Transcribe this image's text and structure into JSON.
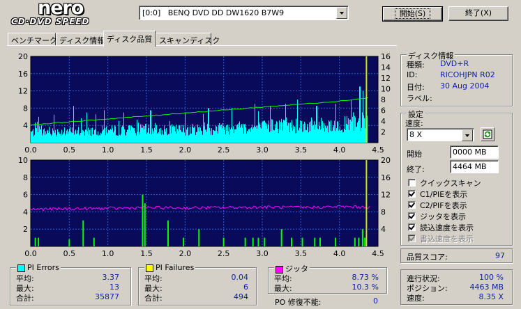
{
  "header": {
    "logo_main": "nero",
    "logo_sub": "CD·DVD SPEED",
    "drive": "[0:0]   BENQ DVD DD DW1620 B7W9",
    "start_label": "開始(S)",
    "stop_label": "終了(X)"
  },
  "tabs": [
    {
      "label": "ベンチマーク",
      "active": false
    },
    {
      "label": "ディスク情報",
      "active": false
    },
    {
      "label": "ディスク品質",
      "active": true
    },
    {
      "label": "スキャンディスク",
      "active": false
    }
  ],
  "disc_info": {
    "title": "ディスク情報",
    "type_label": "種類:",
    "type_value": "DVD+R",
    "id_label": "ID:",
    "id_value": "RICOHJPN R02",
    "date_label": "日付:",
    "date_value": "30 Aug 2004",
    "label_label": "ラベル:"
  },
  "settings": {
    "title": "設定",
    "speed_label": "速度:",
    "speed_value": "8 X",
    "start_label": "開始",
    "start_value": "0000 MB",
    "end_label": "終了:",
    "end_value": "4464 MB",
    "checkboxes": [
      {
        "label": "クイックスキャン",
        "checked": false,
        "disabled": false
      },
      {
        "label": "C1/PIEを表示",
        "checked": true,
        "disabled": false
      },
      {
        "label": "C2/PIFを表示",
        "checked": true,
        "disabled": false
      },
      {
        "label": "ジッタを表示",
        "checked": true,
        "disabled": false
      },
      {
        "label": "読込速度を表示",
        "checked": true,
        "disabled": false
      },
      {
        "label": "書込速度を表示",
        "checked": true,
        "disabled": true
      }
    ]
  },
  "quality": {
    "label": "品質スコア:",
    "value": "97"
  },
  "progress": {
    "status_label": "進行状況:",
    "status_value": "100 %",
    "position_label": "ポジション:",
    "position_value": "4463 MB",
    "speed_label": "速度:",
    "speed_value": "8.35 X"
  },
  "stats": {
    "pi_errors": {
      "title": "PI Errors",
      "color": "#00ffff",
      "avg_label": "平均:",
      "avg": "3.37",
      "max_label": "最大:",
      "max": "13",
      "total_label": "合計:",
      "total": "35877"
    },
    "pi_failures": {
      "title": "PI Failures",
      "color": "#ffff00",
      "avg_label": "平均:",
      "avg": "0.04",
      "max_label": "最大:",
      "max": "6",
      "total_label": "合計:",
      "total": "494"
    },
    "jitter": {
      "title": "ジッタ",
      "color": "#ff00ff",
      "avg_label": "平均:",
      "avg": "8.73 %",
      "max_label": "最大:",
      "max": "10.3 %"
    },
    "po": {
      "label": "PO 修復不能:",
      "value": "0"
    }
  },
  "chart_data": [
    {
      "type": "area",
      "xlim": [
        0,
        4.5
      ],
      "ylim_left": [
        0,
        20
      ],
      "ylim_right": [
        0,
        16
      ],
      "x_ticks": [
        "0.0",
        "0.5",
        "1.0",
        "1.5",
        "2.0",
        "2.5",
        "3.0",
        "3.5",
        "4.0",
        "4.5"
      ],
      "y_ticks_left": [
        "20",
        "16",
        "12",
        "8",
        "4"
      ],
      "y_ticks_right": [
        "16",
        "14",
        "12",
        "10",
        "8",
        "6",
        "4",
        "2"
      ],
      "background": "#0a0a5a",
      "grid_color": "#2f5fd0",
      "series": [
        {
          "role": "pi_errors",
          "color": "#00ffff",
          "axis": "left",
          "x_end": 4.36,
          "base_profile": [
            [
              0,
              2.4
            ],
            [
              0.5,
              2.6
            ],
            [
              1.0,
              2.8
            ],
            [
              1.5,
              3.0
            ],
            [
              2.0,
              3.0
            ],
            [
              2.5,
              3.3
            ],
            [
              3.0,
              3.6
            ],
            [
              3.5,
              4.0
            ],
            [
              4.0,
              4.2
            ],
            [
              4.36,
              4.5
            ]
          ],
          "spikes": [
            [
              0.1,
              6
            ],
            [
              0.3,
              6.5
            ],
            [
              0.55,
              8.5
            ],
            [
              0.72,
              7
            ],
            [
              0.95,
              7.5
            ],
            [
              1.2,
              7
            ],
            [
              1.55,
              7.5
            ],
            [
              2.0,
              7
            ],
            [
              2.3,
              8
            ],
            [
              2.6,
              8
            ],
            [
              2.9,
              9
            ],
            [
              3.1,
              8.5
            ],
            [
              3.3,
              9
            ],
            [
              3.45,
              10
            ],
            [
              3.7,
              8.5
            ],
            [
              3.95,
              9
            ],
            [
              4.15,
              10
            ],
            [
              4.26,
              13
            ],
            [
              4.3,
              12
            ],
            [
              4.34,
              10.5
            ]
          ]
        },
        {
          "role": "read_speed",
          "color": "#00ff00",
          "axis": "right",
          "points": [
            [
              0,
              3.3
            ],
            [
              0.5,
              3.85
            ],
            [
              1.0,
              4.4
            ],
            [
              1.5,
              4.95
            ],
            [
              2.0,
              5.5
            ],
            [
              2.5,
              6.05
            ],
            [
              3.0,
              6.6
            ],
            [
              3.5,
              7.15
            ],
            [
              4.0,
              7.7
            ],
            [
              4.4,
              8.35
            ]
          ]
        }
      ],
      "marker_x": 4.35,
      "marker_color": "#c8e600"
    },
    {
      "type": "line",
      "xlim": [
        0,
        4.5
      ],
      "ylim_left": [
        0,
        10
      ],
      "ylim_right": [
        0,
        20
      ],
      "x_ticks": [
        "0.0",
        "0.5",
        "1.0",
        "1.5",
        "2.0",
        "2.5",
        "3.0",
        "3.5",
        "4.0",
        "4.5"
      ],
      "y_ticks_left": [
        "10",
        "8",
        "6",
        "4",
        "2"
      ],
      "y_ticks_right": [
        "20",
        "16",
        "12",
        "8",
        "4"
      ],
      "background": "#0a0a5a",
      "grid_color": "#2f5fd0",
      "series": [
        {
          "role": "jitter",
          "color": "#ff00ff",
          "axis": "right",
          "points": [
            [
              0,
              8.6
            ],
            [
              0.5,
              8.7
            ],
            [
              1.0,
              8.8
            ],
            [
              1.5,
              9.0
            ],
            [
              2.0,
              8.9
            ],
            [
              2.5,
              9.0
            ],
            [
              3.0,
              9.1
            ],
            [
              3.5,
              9.0
            ],
            [
              4.0,
              9.2
            ],
            [
              4.4,
              9.1
            ]
          ]
        },
        {
          "role": "pi_failures",
          "color": "#00ff00",
          "axis": "left",
          "x_end": 4.36,
          "spikes": [
            [
              0.06,
              1
            ],
            [
              0.1,
              1
            ],
            [
              0.5,
              0.8
            ],
            [
              0.68,
              3
            ],
            [
              0.82,
              1
            ],
            [
              1.45,
              6
            ],
            [
              1.48,
              5
            ],
            [
              1.78,
              3
            ],
            [
              1.98,
              1
            ],
            [
              2.18,
              2
            ],
            [
              2.5,
              1
            ],
            [
              2.78,
              1
            ],
            [
              2.88,
              1
            ],
            [
              2.95,
              1
            ],
            [
              3.03,
              1
            ],
            [
              3.25,
              2
            ],
            [
              3.38,
              1
            ],
            [
              3.52,
              1
            ],
            [
              3.68,
              1
            ],
            [
              3.75,
              1
            ],
            [
              3.95,
              1
            ],
            [
              4.2,
              1
            ],
            [
              4.25,
              1
            ],
            [
              4.3,
              2
            ],
            [
              4.33,
              1
            ]
          ]
        }
      ],
      "marker_x": 4.35,
      "marker_color": "#c8e600"
    }
  ]
}
